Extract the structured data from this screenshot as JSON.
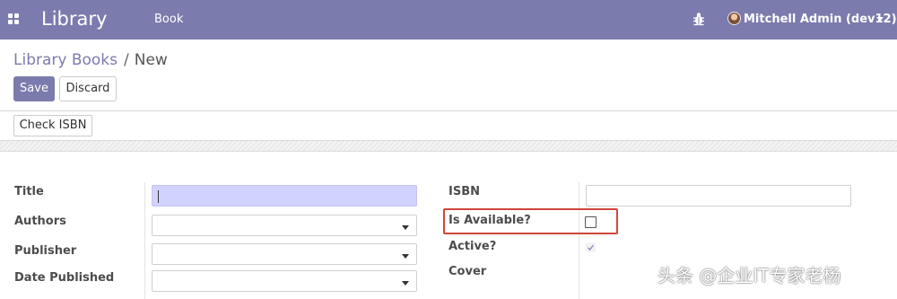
{
  "topbar": {
    "apps_icon": "apps-grid-icon",
    "app_name": "Library",
    "menu_item": "Book",
    "debug_icon": "bug-icon",
    "user_label": "Mitchell Admin (dev12)",
    "background_color": "#7c7bad"
  },
  "breadcrumb": {
    "parent": "Library Books",
    "separator": "/",
    "current": "New"
  },
  "buttons": {
    "save": "Save",
    "discard": "Discard",
    "check_isbn": "Check ISBN"
  },
  "form": {
    "left": {
      "title_label": "Title",
      "title_value": "",
      "authors_label": "Authors",
      "authors_value": "",
      "publisher_label": "Publisher",
      "publisher_value": "",
      "date_published_label": "Date Published",
      "date_published_value": ""
    },
    "right": {
      "isbn_label": "ISBN",
      "isbn_value": "",
      "is_available_label": "Is Available?",
      "is_available_checked": false,
      "active_label": "Active?",
      "active_checked": true,
      "cover_label": "Cover"
    }
  },
  "annotation": {
    "highlight_color": "#d0463c"
  },
  "watermark": {
    "text": "头条 @企业IT专家老杨"
  }
}
